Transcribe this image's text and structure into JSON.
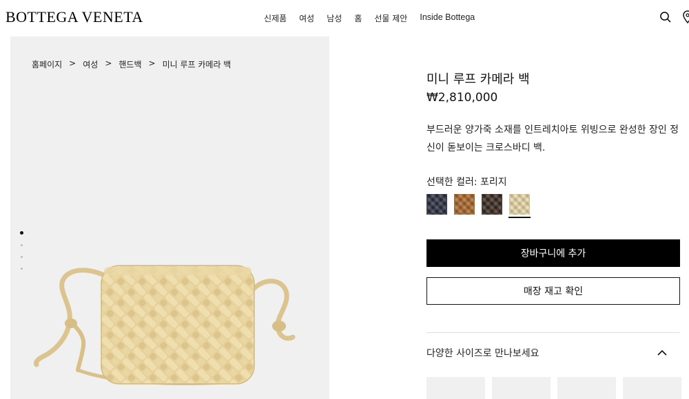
{
  "header": {
    "logo": "BOTTEGA VENETA",
    "nav": [
      "신제품",
      "여성",
      "남성",
      "홈",
      "선물 제안",
      "Inside Bottega"
    ],
    "icons": [
      "search-icon",
      "location-pin-icon"
    ]
  },
  "breadcrumb": {
    "items": [
      "홈페이지",
      "여성",
      "핸드백",
      "미니 루프 카메라 백"
    ],
    "separator": ">"
  },
  "gallery": {
    "image_count": 4,
    "active_index": 0
  },
  "product": {
    "title": "미니 루프 카메라 백",
    "price": "₩2,810,000",
    "description": "부드러운 양가죽 소재를 인트레치아토 위빙으로 완성한 장인 정신이 돋보이는 크로스바디 백.",
    "color_label": "선택한 컬러: 포리지",
    "swatches": [
      {
        "color": "#2b3140",
        "selected": false
      },
      {
        "color": "#a8652a",
        "selected": false
      },
      {
        "color": "#3b2a22",
        "selected": false
      },
      {
        "color": "#e6d6a6",
        "selected": true
      }
    ],
    "add_to_cart": "장바구니에 추가",
    "check_store": "매장 재고 확인",
    "sizes_label": "다양한 사이즈로 만나보세요"
  }
}
